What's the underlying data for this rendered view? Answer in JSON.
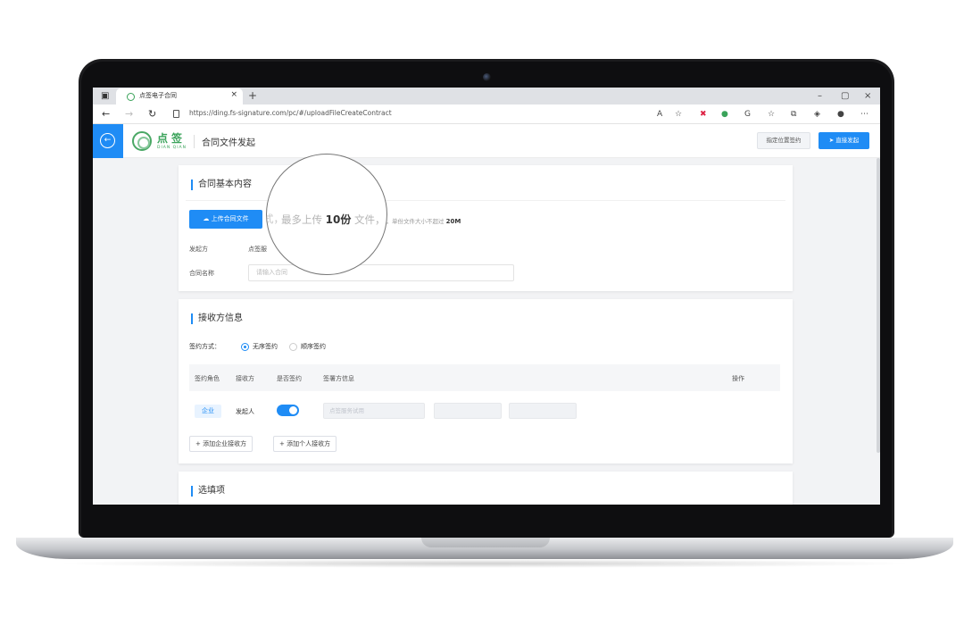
{
  "browser": {
    "tab_title": "点签电子合同",
    "tab_close": "×",
    "new_tab": "+",
    "url": "https://ding.fs-signature.com/pc/#/uploadFileCreateContract",
    "win_min": "–",
    "win_max": "▢",
    "win_close": "×"
  },
  "header": {
    "logo_cn": "点签",
    "logo_en": "DIAN QIAN",
    "page_title": "合同文件发起",
    "btn_position": "指定位置签约",
    "btn_direct": "直接发起",
    "accent": "#1f8cf5",
    "brand": "#3aa35a"
  },
  "basic": {
    "title": "合同基本内容",
    "upload_button": "上传合同文件",
    "upload_tip_prefix": "件，单份文件大小不超过",
    "upload_tip_limit": "20M",
    "magnifier_prefix": "式，",
    "magnifier_text_before": "最多上传",
    "magnifier_count": "10份",
    "magnifier_text_after": "文件，",
    "initiator_label": "发起方",
    "initiator_value": "点签服",
    "contract_name_label": "合同名称",
    "contract_name_placeholder": "请输入合同"
  },
  "receiver": {
    "title": "接收方信息",
    "sign_mode_label": "签约方式：",
    "sign_modes": [
      "无序签约",
      "顺序签约"
    ],
    "selected_mode": "无序签约",
    "columns": [
      "签约角色",
      "接收方",
      "是否签约",
      "签署方信息",
      "操作"
    ],
    "row": {
      "role": "企业",
      "receiver": "发起人",
      "signing_enabled": true,
      "field1": "点签服务试用",
      "field2": "",
      "field3": ""
    },
    "add_company": "+ 添加企业接收方",
    "add_person": "+ 添加个人接收方"
  },
  "options": {
    "title": "选填项"
  },
  "icons": {
    "back": "arrow-left-circle-icon",
    "upload": "cloud-upload-icon",
    "send": "paper-plane-icon"
  }
}
